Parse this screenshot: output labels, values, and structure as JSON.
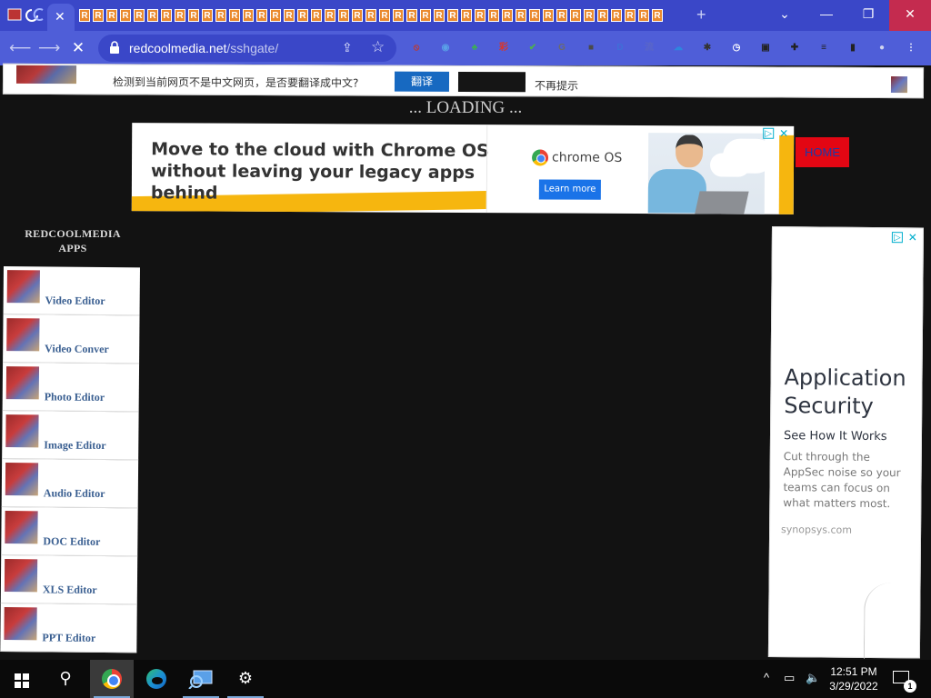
{
  "browser": {
    "tab_favicon_letter": "R",
    "tab_favicon_count": 43,
    "new_tab_label": "+",
    "window_controls": {
      "dropdown": "⌄",
      "minimize": "—",
      "restore": "❐",
      "close": "✕"
    },
    "close_hover_color": "#c42b4f",
    "url_host": "redcoolmedia.net",
    "url_path": "/sshgate/",
    "extensions": [
      {
        "name": "ext-block-icon",
        "glyph": "⦸",
        "color": "#c0392b"
      },
      {
        "name": "ext-circle-icon",
        "glyph": "◉",
        "color": "#5aa0e8"
      },
      {
        "name": "ext-tree-icon",
        "glyph": "♣",
        "color": "#3cae55"
      },
      {
        "name": "ext-puzzle-badge-icon",
        "glyph": "彩",
        "color": "#d9362a"
      },
      {
        "name": "ext-check-icon",
        "glyph": "✔",
        "color": "#4caf50"
      },
      {
        "name": "ext-g-icon",
        "glyph": "G",
        "color": "#6b6b6b"
      },
      {
        "name": "ext-square-icon",
        "glyph": "■",
        "color": "#4a4a4a"
      },
      {
        "name": "ext-d-icon",
        "glyph": "D",
        "color": "#3f6fd8"
      },
      {
        "name": "ext-flow-icon",
        "glyph": "流",
        "color": "#5a66c8"
      },
      {
        "name": "ext-cloud-icon",
        "glyph": "☁",
        "color": "#2e86de"
      },
      {
        "name": "ext-bug-icon",
        "glyph": "✱",
        "color": "#333333"
      },
      {
        "name": "ext-clock-icon",
        "glyph": "◷",
        "color": "#ffffff"
      },
      {
        "name": "ext-save-icon",
        "glyph": "▣",
        "color": "#222222"
      },
      {
        "name": "extensions-puzzle-icon",
        "glyph": "✚",
        "color": "#222222"
      },
      {
        "name": "media-queue-icon",
        "glyph": "≡",
        "color": "#222222"
      },
      {
        "name": "side-panel-icon",
        "glyph": "▮",
        "color": "#222222"
      },
      {
        "name": "profile-avatar-icon",
        "glyph": "●",
        "color": "#d0d4ee"
      },
      {
        "name": "kebab-menu-icon",
        "glyph": "⋮",
        "color": "#ffffff"
      }
    ]
  },
  "translate_bar": {
    "message": "检测到当前网页不是中文网页，是否要翻译成中文?",
    "translate_button": "翻译",
    "no_prompt": "不再提示"
  },
  "page": {
    "loading_text": "... LOADING ...",
    "home_button": "HOME",
    "top_ad": {
      "headline_line1": "Move to the cloud with Chrome OS",
      "headline_line2": "without leaving your legacy apps behind",
      "brand": "chrome OS",
      "cta": "Learn more"
    },
    "sidebar_title_line1": "REDCOOLMEDIA",
    "sidebar_title_line2": "APPS",
    "apps": [
      {
        "label": "Video Editor"
      },
      {
        "label": "Video Conver"
      },
      {
        "label": "Photo Editor"
      },
      {
        "label": "Image Editor"
      },
      {
        "label": "Audio Editor"
      },
      {
        "label": "DOC Editor"
      },
      {
        "label": "XLS Editor"
      },
      {
        "label": "PPT Editor"
      }
    ],
    "side_ad": {
      "title": "Application Security",
      "subtitle": "See How It Works",
      "body": "Cut through the AppSec noise so your teams can focus on what matters most.",
      "source": "synopsys.com"
    }
  },
  "taskbar": {
    "time": "12:51 PM",
    "date": "3/29/2022",
    "notification_count": "1"
  }
}
